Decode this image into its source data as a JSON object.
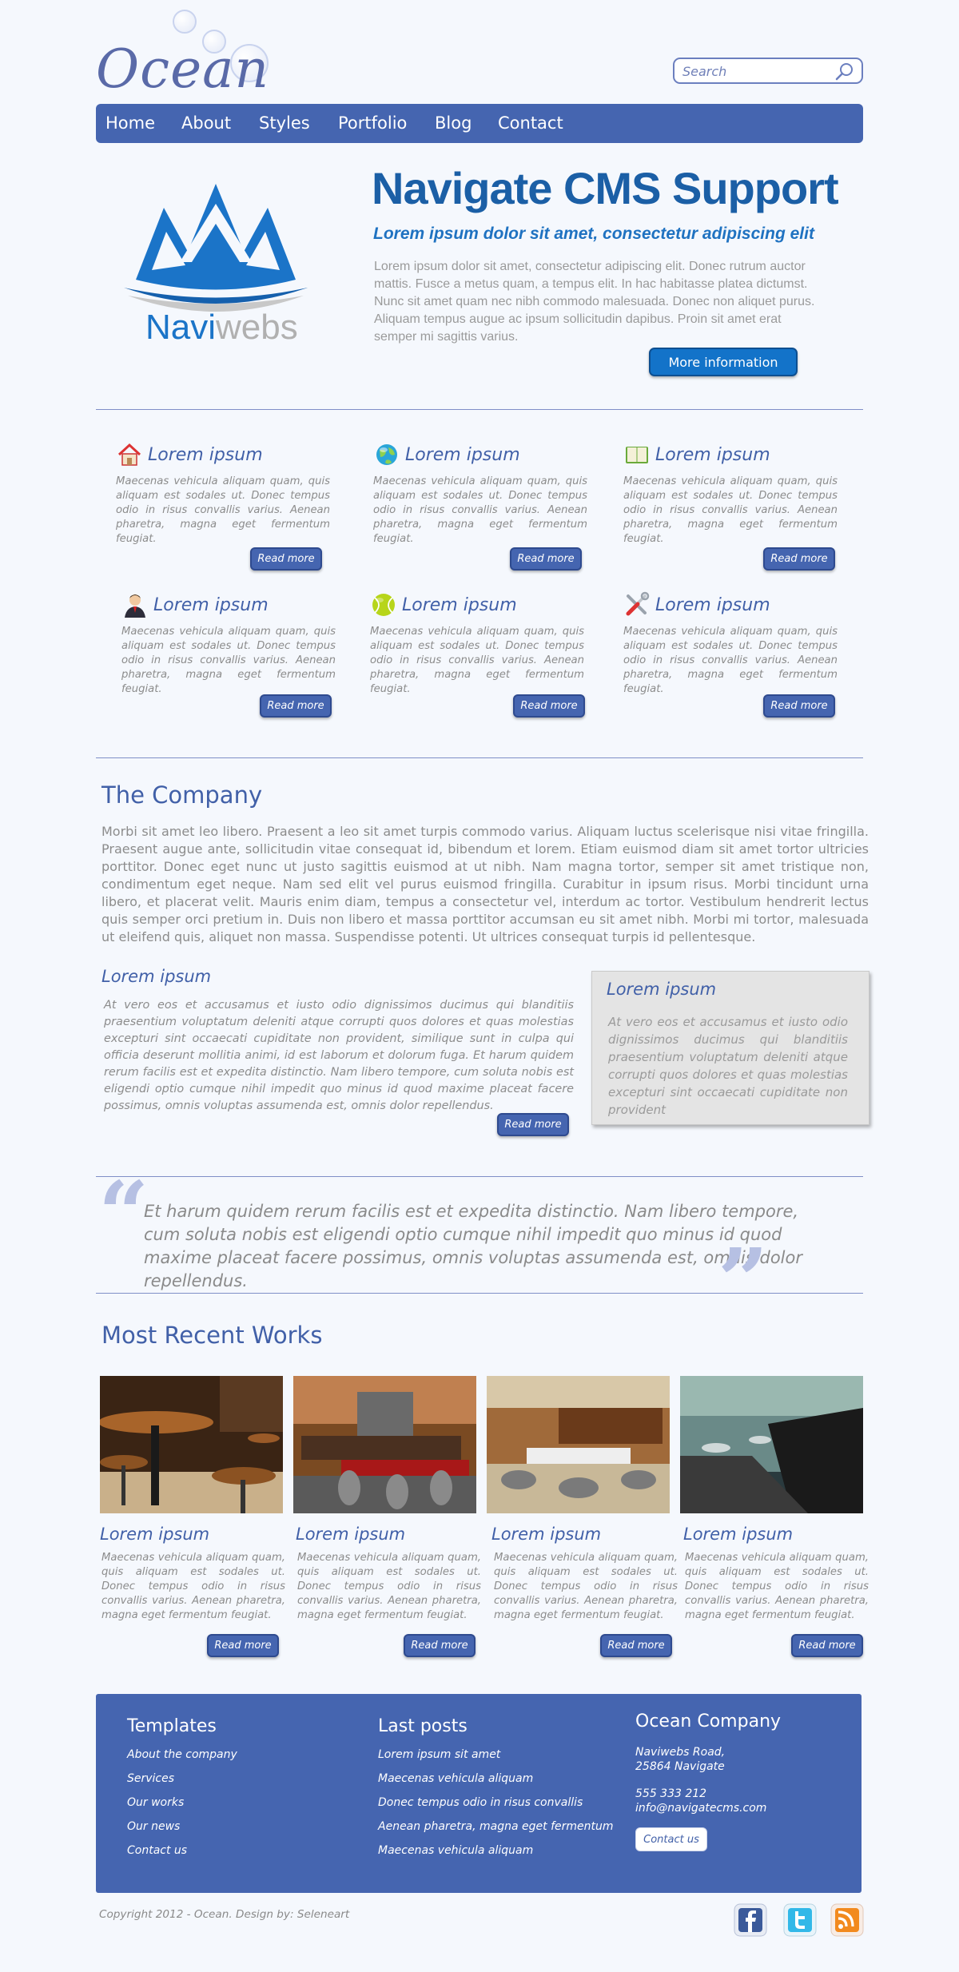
{
  "header": {
    "logo_text": "Ocean",
    "search_placeholder": "Search"
  },
  "nav": {
    "items": [
      "Home",
      "About",
      "Styles",
      "Portfolio",
      "Blog",
      "Contact"
    ]
  },
  "hero": {
    "logo_word_navi": "Navi",
    "logo_word_webs": "webs",
    "title": "Navigate CMS Support",
    "subtitle": "Lorem ipsum dolor sit amet, consectetur adipiscing elit",
    "text": "Lorem ipsum dolor sit amet, consectetur adipiscing elit. Donec rutrum auctor mattis. Fusce a metus quam, a tempus elit. In hac habitasse platea dictumst. Nunc sit amet quam nec nibh commodo malesuada. Donec non aliquet purus. Aliquam tempus augue ac ipsum sollicitudin dapibus. Proin sit amet erat semper mi sagittis varius.",
    "button": "More information"
  },
  "features": [
    {
      "icon": "house-icon",
      "title": "Lorem ipsum",
      "text": "Maecenas vehicula aliquam quam, quis aliquam est sodales ut. Donec tempus odio in risus convallis varius. Aenean pharetra, magna eget fermentum feugiat.",
      "button": "Read more"
    },
    {
      "icon": "globe-icon",
      "title": "Lorem ipsum",
      "text": "Maecenas vehicula aliquam quam, quis aliquam est sodales ut. Donec tempus odio in risus convallis varius. Aenean pharetra, magna eget fermentum feugiat.",
      "button": "Read more"
    },
    {
      "icon": "book-icon",
      "title": "Lorem ipsum",
      "text": "Maecenas vehicula aliquam quam, quis aliquam est sodales ut. Donec tempus odio in risus convallis varius. Aenean pharetra, magna eget fermentum feugiat.",
      "button": "Read more"
    },
    {
      "icon": "businessman-icon",
      "title": "Lorem ipsum",
      "text": "Maecenas vehicula aliquam quam, quis aliquam est sodales ut. Donec tempus odio in risus convallis varius. Aenean pharetra, magna eget fermentum feugiat.",
      "button": "Read more"
    },
    {
      "icon": "tennis-ball-icon",
      "title": "Lorem ipsum",
      "text": "Maecenas vehicula aliquam quam, quis aliquam est sodales ut. Donec tempus odio in risus convallis varius. Aenean pharetra, magna eget fermentum feugiat.",
      "button": "Read more"
    },
    {
      "icon": "tools-icon",
      "title": "Lorem ipsum",
      "text": "Maecenas vehicula aliquam quam, quis aliquam est sodales ut. Donec tempus odio in risus convallis varius. Aenean pharetra, magna eget fermentum feugiat.",
      "button": "Read more"
    }
  ],
  "company": {
    "title": "The Company",
    "text": "Morbi sit amet leo libero. Praesent a leo sit amet turpis commodo varius. Aliquam luctus scelerisque nisi vitae fringilla. Praesent augue ante, sollicitudin vitae consequat id, bibendum et lorem. Etiam euismod diam sit amet tortor ultricies porttitor. Donec eget nunc ut justo sagittis euismod at ut nibh. Nam magna tortor, semper sit amet tristique non, condimentum eget neque. Nam sed elit vel purus euismod fringilla. Curabitur in ipsum risus. Morbi tincidunt urna libero, et placerat velit. Mauris enim diam, tempus a consectetur vel, interdum ac tortor. Vestibulum hendrerit lectus quis semper orci pretium in. Duis non libero et massa porttitor accumsan eu sit amet nibh. Morbi mi tortor, malesuada ut eleifend quis, aliquet non massa. Suspendisse potenti. Ut ultrices consequat turpis id pellentesque.",
    "left_title": "Lorem ipsum",
    "left_text": "At vero eos et accusamus et iusto odio dignissimos ducimus qui blanditiis praesentium voluptatum deleniti atque corrupti quos dolores et quas molestias excepturi sint occaecati cupiditate non provident, similique sunt in culpa qui officia deserunt mollitia animi, id est laborum et dolorum fuga. Et harum quidem rerum facilis est et expedita distinctio. Nam libero tempore, cum soluta nobis est eligendi optio cumque nihil impedit quo minus id quod maxime placeat facere possimus, omnis voluptas assumenda est, omnis dolor repellendus.",
    "left_button": "Read more",
    "box_title": "Lorem ipsum",
    "box_text": "At vero eos et accusamus et iusto odio dignissimos ducimus qui blanditiis praesentium voluptatum deleniti atque corrupti quos dolores et quas molestias excepturi sint occaecati cupiditate non provident"
  },
  "quote": {
    "open_mark": "“",
    "close_mark": "”",
    "text": "Et harum quidem rerum facilis est et expedita distinctio. Nam libero tempore, cum soluta nobis est eligendi optio cumque nihil impedit quo minus id quod maxime placeat facere possimus, omnis voluptas assumenda est, omnis dolor repellendus."
  },
  "works": {
    "title": "Most Recent Works",
    "items": [
      {
        "title": "Lorem ipsum",
        "text": "Maecenas vehicula aliquam quam, quis aliquam est sodales ut. Donec tempus odio in risus convallis varius. Aenean pharetra, magna eget fermentum feugiat.",
        "button": "Read more"
      },
      {
        "title": "Lorem ipsum",
        "text": "Maecenas vehicula aliquam quam, quis aliquam est sodales ut. Donec tempus odio in risus convallis varius. Aenean pharetra, magna eget fermentum feugiat.",
        "button": "Read more"
      },
      {
        "title": "Lorem ipsum",
        "text": "Maecenas vehicula aliquam quam, quis aliquam est sodales ut. Donec tempus odio in risus convallis varius. Aenean pharetra, magna eget fermentum feugiat.",
        "button": "Read more"
      },
      {
        "title": "Lorem ipsum",
        "text": "Maecenas vehicula aliquam quam, quis aliquam est sodales ut. Donec tempus odio in risus convallis varius. Aenean pharetra, magna eget fermentum feugiat.",
        "button": "Read more"
      }
    ]
  },
  "footer": {
    "templates_title": "Templates",
    "templates_links": [
      "About the company",
      "Services",
      "Our works",
      "Our news",
      "Contact us"
    ],
    "posts_title": "Last posts",
    "posts_links": [
      "Lorem ipsum sit amet",
      "Maecenas vehicula aliquam",
      "Donec tempus odio in risus convallis",
      "Aenean pharetra, magna eget fermentum",
      "Maecenas vehicula aliquam"
    ],
    "company_title": "Ocean Company",
    "address_line1": "Naviwebs Road,",
    "address_line2": "25864 Navigate",
    "phone": "555 333 212",
    "email": "info@navigatecms.com",
    "contact_button": "Contact us",
    "copyright": "Copyright 2012 - Ocean. Design by: Seleneart",
    "social": [
      "facebook-icon",
      "twitter-icon",
      "rss-icon"
    ]
  },
  "colors": {
    "brand_blue": "#4565b0",
    "hero_blue": "#1b5fa6",
    "background": "#f5f8fd"
  }
}
